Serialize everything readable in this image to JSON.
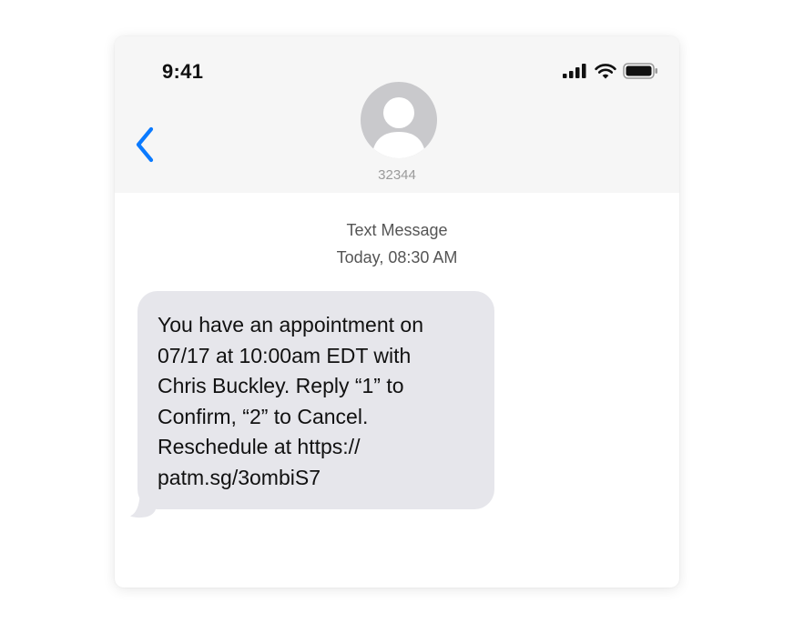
{
  "status_bar": {
    "time": "9:41",
    "icons": [
      "cellular-signal-icon",
      "wifi-icon",
      "battery-icon"
    ]
  },
  "header": {
    "back_icon": "chevron-left-icon",
    "avatar_icon": "person-icon",
    "contact_number": "32344"
  },
  "conversation": {
    "service_label": "Text Message",
    "timestamp": "Today, 08:30 AM",
    "messages": [
      {
        "direction": "incoming",
        "text": "You have an appointment on\n07/17 at 10:00am EDT with\nChris Buckley. Reply “1” to\nConfirm, “2” to Cancel.\nReschedule at https://\npatm.sg/3ombiS7"
      }
    ]
  },
  "colors": {
    "accent": "#0a7aff",
    "incoming_bubble": "#e6e6eb",
    "header_background": "#f6f6f6",
    "avatar": "#c9c9cc"
  }
}
